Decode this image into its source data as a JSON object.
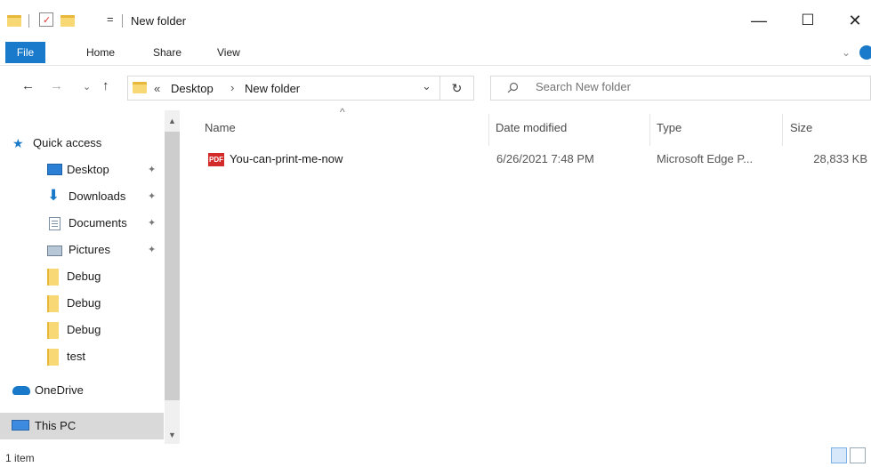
{
  "window": {
    "title": "New folder",
    "qat_dropdown": "=",
    "controls": {
      "minimize": "—",
      "maximize": "☐",
      "close": "✕"
    }
  },
  "ribbon": {
    "tabs": [
      {
        "label": "File"
      },
      {
        "label": "Home"
      },
      {
        "label": "Share"
      },
      {
        "label": "View"
      }
    ],
    "expand": "⌄"
  },
  "nav": {
    "back": "←",
    "forward": "→",
    "recent": "⌄",
    "up": "↑",
    "address": {
      "overflow": "«",
      "segments": [
        "Desktop",
        "New folder"
      ],
      "separator": "›",
      "dropdown": "⌄"
    },
    "refresh": "↻",
    "search_placeholder": "Search New folder"
  },
  "sidebar": {
    "items": [
      {
        "label": "Quick access",
        "icon": "star-icon"
      },
      {
        "label": "Desktop",
        "icon": "desktop-icon",
        "pinned": true
      },
      {
        "label": "Downloads",
        "icon": "download-icon",
        "pinned": true
      },
      {
        "label": "Documents",
        "icon": "documents-icon",
        "pinned": true
      },
      {
        "label": "Pictures",
        "icon": "pictures-icon",
        "pinned": true
      },
      {
        "label": "Debug",
        "icon": "folder-icon"
      },
      {
        "label": "Debug",
        "icon": "folder-icon"
      },
      {
        "label": "Debug",
        "icon": "folder-icon"
      },
      {
        "label": "test",
        "icon": "folder-icon"
      },
      {
        "label": "OneDrive",
        "icon": "cloud-icon"
      },
      {
        "label": "This PC",
        "icon": "computer-icon",
        "selected": true
      }
    ],
    "pin_glyph": "📌"
  },
  "filelist": {
    "columns": [
      "Name",
      "Date modified",
      "Type",
      "Size"
    ],
    "sort_indicator": "^",
    "rows": [
      {
        "name": "You-can-print-me-now",
        "date_modified": "6/26/2021 7:48 PM",
        "type": "Microsoft Edge P...",
        "size": "28,833 KB",
        "icon": "pdf-icon",
        "icon_text": "PDF"
      }
    ]
  },
  "status": {
    "item_count": "1 item"
  },
  "colors": {
    "accent": "#1979ca",
    "selection": "#cce8ff",
    "folder": "#f8d775"
  }
}
